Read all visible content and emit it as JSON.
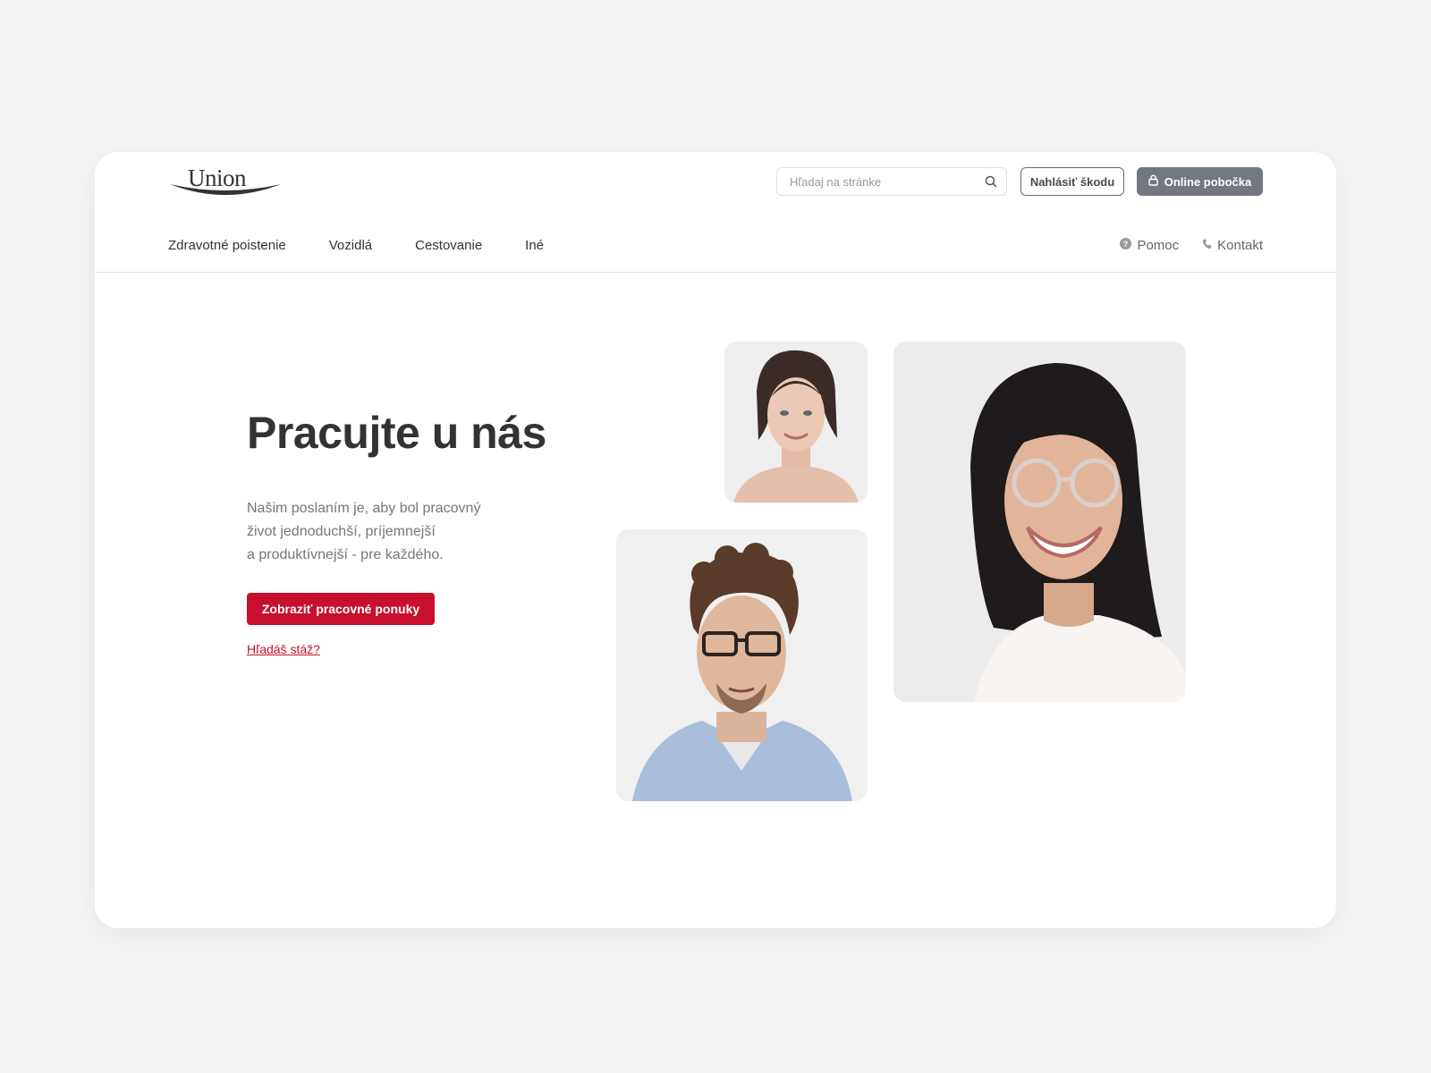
{
  "brand": {
    "logo_text": "Union",
    "accent": "#c8102e",
    "branch_button_color": "#737880"
  },
  "header": {
    "search": {
      "placeholder": "Hľadaj na stránke",
      "icon": "search-icon"
    },
    "report_damage_label": "Nahlásiť škodu",
    "online_branch_label": "Online pobočka",
    "online_branch_icon": "lock-icon"
  },
  "nav": {
    "items": [
      {
        "label": "Zdravotné poistenie"
      },
      {
        "label": "Vozidlá"
      },
      {
        "label": "Cestovanie"
      },
      {
        "label": "Iné"
      }
    ],
    "help": {
      "label": "Pomoc",
      "icon": "help-circle-icon"
    },
    "contact": {
      "label": "Kontakt",
      "icon": "phone-icon"
    }
  },
  "hero": {
    "title": "Pracujte u nás",
    "lines": [
      "Našim poslaním je, aby bol pracovný",
      "život jednoduchší, príjemnejší",
      "a produktívnejší - pre každého."
    ],
    "cta_label": "Zobraziť pracovné ponuky",
    "internship_link": "Hľadáš stáž?"
  },
  "photos": [
    {
      "name": "portrait-woman-smiling"
    },
    {
      "name": "portrait-man-glasses"
    },
    {
      "name": "portrait-woman-glasses"
    }
  ]
}
